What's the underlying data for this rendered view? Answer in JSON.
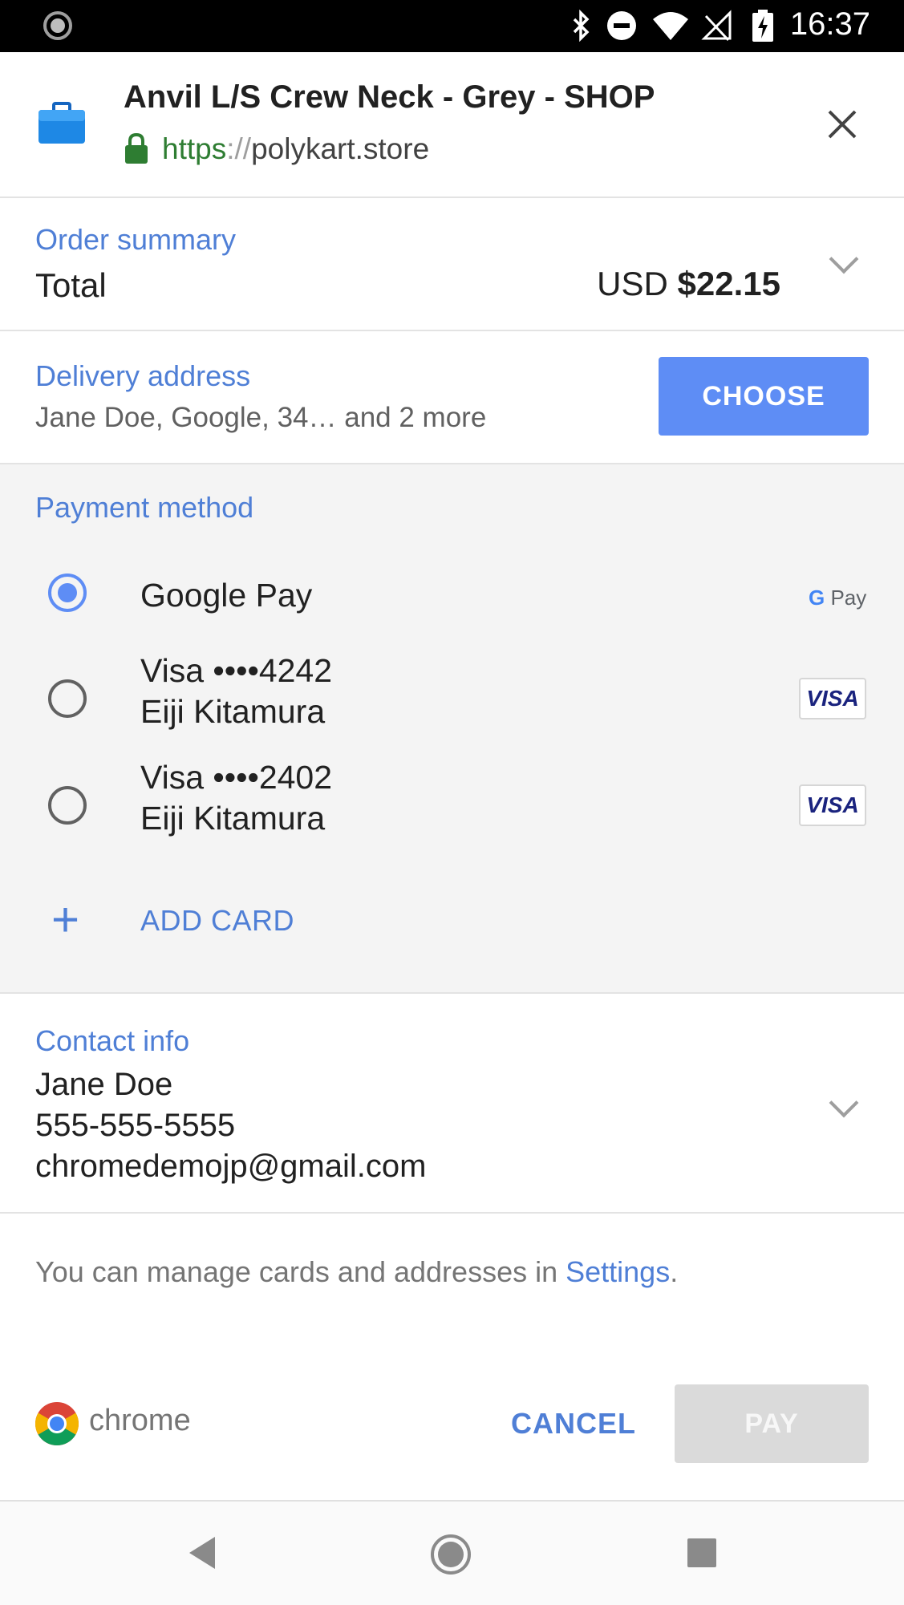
{
  "status_bar": {
    "time": "16:37",
    "icons": [
      "loading-indicator-icon",
      "bluetooth-icon",
      "do-not-disturb-icon",
      "wifi-icon",
      "no-signal-icon",
      "battery-charging-icon"
    ]
  },
  "header": {
    "title": "Anvil L/S Crew Neck - Grey - SHOP",
    "url_scheme": "https",
    "url_separator": "://",
    "url_host": "polykart.store",
    "icons": [
      "shopping-bag-icon",
      "lock-icon",
      "close-icon"
    ]
  },
  "order_summary": {
    "label": "Order summary",
    "total_label": "Total",
    "currency": "USD",
    "amount": "$22.15"
  },
  "delivery": {
    "label": "Delivery address",
    "value": "Jane Doe, Google, 34… and 2 more",
    "choose_label": "CHOOSE"
  },
  "payment": {
    "label": "Payment method",
    "methods": [
      {
        "name": "Google Pay",
        "holder": "",
        "selected": true,
        "logo": "G Pay"
      },
      {
        "name": "Visa  ••••4242",
        "holder": "Eiji Kitamura",
        "selected": false,
        "logo": "VISA"
      },
      {
        "name": "Visa  ••••2402",
        "holder": "Eiji Kitamura",
        "selected": false,
        "logo": "VISA"
      }
    ],
    "add_card_label": "ADD CARD"
  },
  "contact": {
    "label": "Contact info",
    "name": "Jane Doe",
    "phone": "555-555-5555",
    "email": "chromedemojp@gmail.com"
  },
  "manage_note": {
    "text": "You can manage cards and addresses in ",
    "link": "Settings",
    "suffix": "."
  },
  "footer": {
    "brand": "chrome",
    "cancel_label": "CANCEL",
    "pay_label": "PAY"
  },
  "colors": {
    "accent": "#5e8df5",
    "link": "#4f7fd6",
    "secure": "#2e7d32",
    "disabled_button": "#dadada"
  }
}
